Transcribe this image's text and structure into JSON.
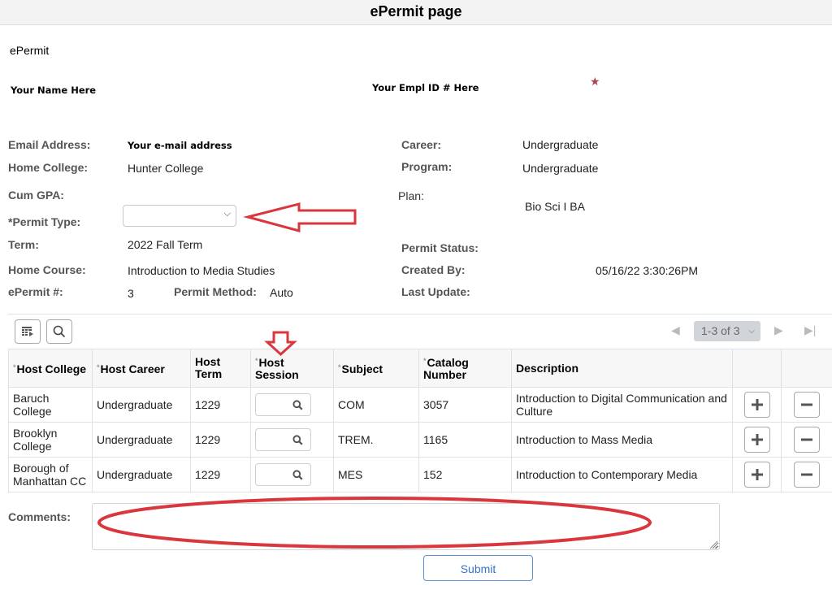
{
  "page": {
    "title": "ePermit page",
    "section_title": "ePermit"
  },
  "identity": {
    "name": "Your Name Here",
    "empl_id": "Your Empl ID # Here",
    "star_icon": "star-icon"
  },
  "left_fields": {
    "email_label": "Email Address:",
    "email_value": "Your e-mail address",
    "home_college_label": "Home College:",
    "home_college_value": "Hunter College",
    "cum_gpa_label": "Cum GPA:",
    "cum_gpa_value": "",
    "permit_type_label": "*Permit Type:",
    "permit_type_value": "",
    "term_label": "Term:",
    "term_value": "2022 Fall Term",
    "home_course_label": "Home Course:",
    "home_course_value": "Introduction to Media Studies",
    "epermit_num_label": "ePermit #:",
    "epermit_num_value": "3",
    "permit_method_label": "Permit Method:",
    "permit_method_value": "Auto"
  },
  "right_fields": {
    "career_label": "Career:",
    "career_value": "Undergraduate",
    "program_label": "Program:",
    "program_value": "Undergraduate",
    "plan_label": "Plan:",
    "plan_value": "Bio Sci I BA",
    "permit_status_label": "Permit Status:",
    "permit_status_value": "",
    "created_by_label": "Created By:",
    "created_by_value": "05/16/22  3:30:26PM",
    "last_update_label": "Last Update:",
    "last_update_value": ""
  },
  "grid": {
    "toolbar": {
      "personalize_icon": "grid-settings-icon",
      "find_icon": "search-icon"
    },
    "pager": {
      "range": "1-3 of 3"
    },
    "columns": [
      {
        "label": "Host College",
        "required": true
      },
      {
        "label": "Host Career",
        "required": true
      },
      {
        "label": "Host Term",
        "required": false
      },
      {
        "label": "Host Session",
        "required": true
      },
      {
        "label": "Subject",
        "required": true
      },
      {
        "label": "Catalog Number",
        "required": true
      },
      {
        "label": "Description",
        "required": false
      },
      {
        "label": "",
        "required": false
      },
      {
        "label": "",
        "required": false
      }
    ],
    "rows": [
      {
        "host_college": "Baruch College",
        "host_career": "Undergraduate",
        "host_term": "1229",
        "host_session": "",
        "subject": "COM",
        "catalog": "3057",
        "description": "Introduction to Digital Communication and Culture"
      },
      {
        "host_college": "Brooklyn College",
        "host_career": "Undergraduate",
        "host_term": "1229",
        "host_session": "",
        "subject": "TREM.",
        "catalog": "1165",
        "description": "Introduction to Mass Media"
      },
      {
        "host_college": "Borough of Manhattan CC",
        "host_career": "Undergraduate",
        "host_term": "1229",
        "host_session": "",
        "subject": "MES",
        "catalog": "152",
        "description": "Introduction to Contemporary Media"
      }
    ],
    "add_row_label": "+",
    "delete_row_label": "−"
  },
  "comments": {
    "label": "Comments:",
    "value": ""
  },
  "submit_label": "Submit",
  "annotations": {
    "color": "#d9363e"
  }
}
